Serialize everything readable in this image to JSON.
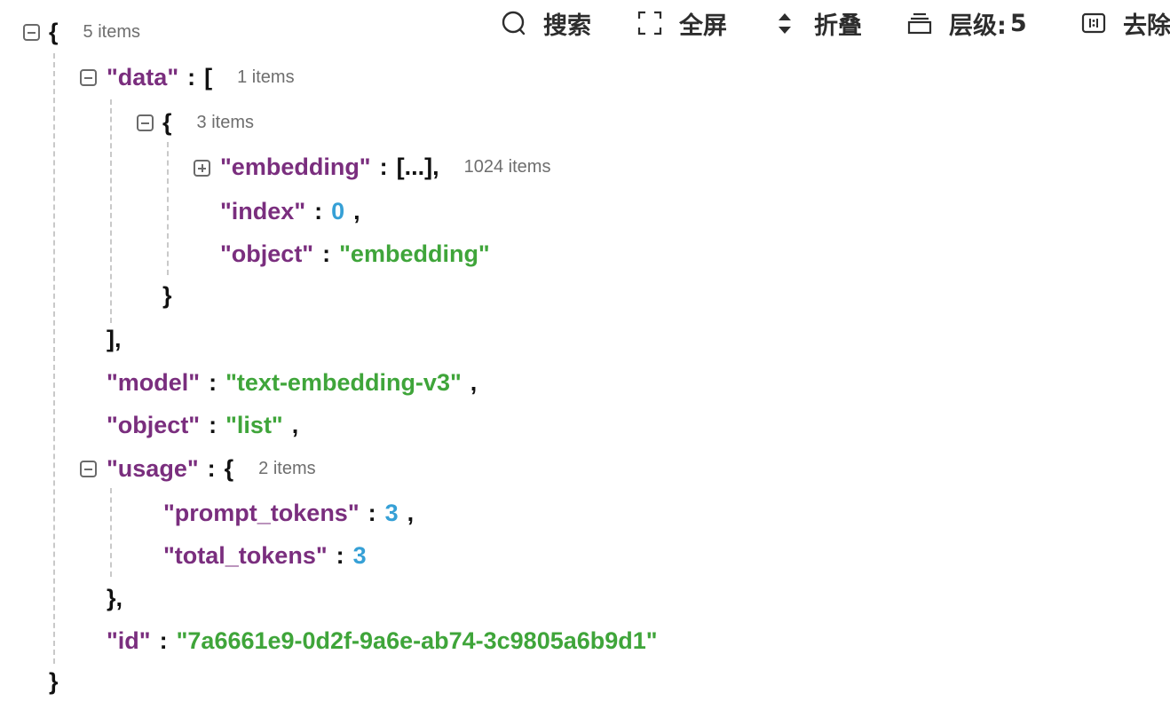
{
  "toolbar": {
    "search": {
      "icon": "search-icon",
      "label": "搜索"
    },
    "fullscreen": {
      "icon": "fullscreen-icon",
      "label": "全屏"
    },
    "collapse": {
      "icon": "collapse-icon",
      "label": "折叠"
    },
    "level": {
      "icon": "layers-icon",
      "label": "层级:",
      "value": "5"
    },
    "strip": {
      "icon": "strip-icon",
      "label": "去除"
    }
  },
  "tree": {
    "root": {
      "open": "{",
      "count": "5 items",
      "close": "}"
    },
    "data": {
      "key": "\"data\"",
      "colon": ":",
      "open": "[",
      "count": "1 items",
      "close": "],",
      "item": {
        "open": "{",
        "count": "3 items",
        "close": "}",
        "embedding": {
          "key": "\"embedding\"",
          "colon": ":",
          "value": "[...],",
          "count": "1024 items"
        },
        "index": {
          "key": "\"index\"",
          "colon": ":",
          "value": "0",
          "comma": ","
        },
        "object": {
          "key": "\"object\"",
          "colon": ":",
          "value": "\"embedding\""
        }
      }
    },
    "model": {
      "key": "\"model\"",
      "colon": ":",
      "value": "\"text-embedding-v3\"",
      "comma": ","
    },
    "object": {
      "key": "\"object\"",
      "colon": ":",
      "value": "\"list\"",
      "comma": ","
    },
    "usage": {
      "key": "\"usage\"",
      "colon": ":",
      "open": "{",
      "count": "2 items",
      "close": "},",
      "prompt_tokens": {
        "key": "\"prompt_tokens\"",
        "colon": ":",
        "value": "3",
        "comma": ","
      },
      "total_tokens": {
        "key": "\"total_tokens\"",
        "colon": ":",
        "value": "3"
      }
    },
    "id": {
      "key": "\"id\"",
      "colon": ":",
      "value": "\"7a6661e9-0d2f-9a6e-ab74-3c9805a6b9d1\""
    }
  },
  "colors": {
    "key": "#7a2e7e",
    "string": "#3fa53a",
    "number": "#36a0d6",
    "count": "#6e6e6e",
    "guide": "#c9c9c9"
  }
}
